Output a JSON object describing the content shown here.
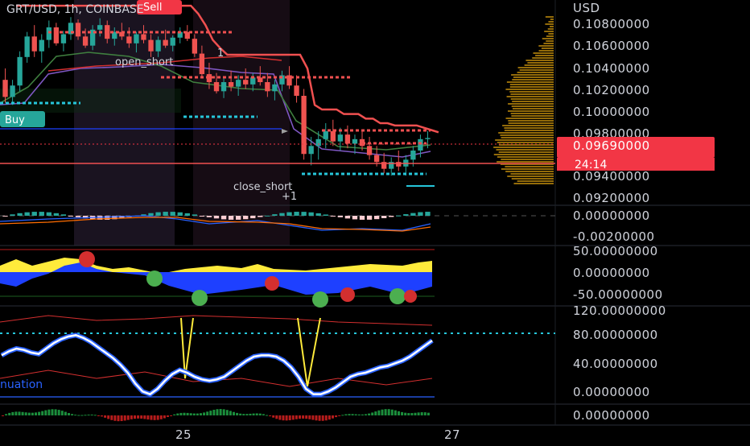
{
  "symbol": {
    "pair": "GRT/USD",
    "interval": "1h",
    "exchange": "COINBASE",
    "header_text": "GRT/USD, 1h, COINBASE"
  },
  "currency_label": "USD",
  "colors": {
    "background": "#000000",
    "candle_up": "#26a69a",
    "candle_down": "#ef5350",
    "price_badge": "#f23645",
    "sell_badge": "#f23645",
    "buy_badge": "#26a69a",
    "stop_line": "#f05050",
    "rsi_line": "#ffffff",
    "rsi_shadow": "#2962ff",
    "osc_fill_yellow": "#ffeb3b",
    "osc_fill_blue": "#1e40ff",
    "dotted_level": "#26c6da"
  },
  "annotations": {
    "sell_badge": "Sell",
    "buy_badge": "Buy",
    "open_short": "open_short",
    "open_short_count": "1",
    "close_short": "close_short",
    "close_short_count": "+1",
    "continuation": "nuation"
  },
  "last_price": {
    "value": "0.09690000",
    "countdown": "24:14"
  },
  "x_axis_labels": [
    "25",
    "27"
  ],
  "chart_data": [
    {
      "type": "candlestick",
      "panel": "price",
      "y_tick_labels": [
        "0.10800000",
        "0.10600000",
        "0.10400000",
        "0.10200000",
        "0.10000000",
        "0.09800000",
        "0.09400000",
        "0.09200000"
      ],
      "ylim": [
        0.091,
        0.109
      ],
      "last_price": 0.0969,
      "candles_ohlc": [
        [
          0.102,
          0.103,
          0.1,
          0.1005
        ],
        [
          0.1005,
          0.102,
          0.0998,
          0.1015
        ],
        [
          0.1015,
          0.1045,
          0.101,
          0.104
        ],
        [
          0.104,
          0.1062,
          0.1035,
          0.1058
        ],
        [
          0.1058,
          0.1068,
          0.104,
          0.1045
        ],
        [
          0.1045,
          0.106,
          0.1035,
          0.1055
        ],
        [
          0.1055,
          0.1072,
          0.1048,
          0.1066
        ],
        [
          0.1066,
          0.107,
          0.105,
          0.1052
        ],
        [
          0.1052,
          0.1063,
          0.1045,
          0.106
        ],
        [
          0.106,
          0.1075,
          0.1055,
          0.107
        ],
        [
          0.107,
          0.1073,
          0.1055,
          0.1058
        ],
        [
          0.1058,
          0.1065,
          0.1048,
          0.105
        ],
        [
          0.105,
          0.1068,
          0.1046,
          0.1064
        ],
        [
          0.1064,
          0.1074,
          0.1058,
          0.1068
        ],
        [
          0.1068,
          0.1072,
          0.1052,
          0.1056
        ],
        [
          0.1056,
          0.1066,
          0.105,
          0.1062
        ],
        [
          0.1062,
          0.107,
          0.1055,
          0.1058
        ],
        [
          0.1058,
          0.1066,
          0.1048,
          0.1052
        ],
        [
          0.1052,
          0.1062,
          0.1044,
          0.106
        ],
        [
          0.106,
          0.1068,
          0.1052,
          0.1055
        ],
        [
          0.1055,
          0.106,
          0.104,
          0.1045
        ],
        [
          0.1045,
          0.1058,
          0.104,
          0.1055
        ],
        [
          0.1055,
          0.1064,
          0.1048,
          0.105
        ],
        [
          0.105,
          0.1059,
          0.1045,
          0.1057
        ],
        [
          0.1057,
          0.1066,
          0.1052,
          0.1062
        ],
        [
          0.1062,
          0.1068,
          0.1054,
          0.1056
        ],
        [
          0.1056,
          0.106,
          0.104,
          0.1043
        ],
        [
          0.1043,
          0.105,
          0.1022,
          0.1025
        ],
        [
          0.1025,
          0.1035,
          0.1012,
          0.1018
        ],
        [
          0.1018,
          0.1026,
          0.1008,
          0.101
        ],
        [
          0.101,
          0.1022,
          0.1004,
          0.1018
        ],
        [
          0.1018,
          0.1028,
          0.101,
          0.1014
        ],
        [
          0.1014,
          0.1024,
          0.1006,
          0.102
        ],
        [
          0.102,
          0.103,
          0.1012,
          0.1016
        ],
        [
          0.1016,
          0.1026,
          0.101,
          0.1022
        ],
        [
          0.1022,
          0.1032,
          0.1015,
          0.1018
        ],
        [
          0.1018,
          0.1026,
          0.1005,
          0.101
        ],
        [
          0.101,
          0.102,
          0.1002,
          0.1016
        ],
        [
          0.1016,
          0.1028,
          0.101,
          0.1024
        ],
        [
          0.1024,
          0.1032,
          0.1012,
          0.1015
        ],
        [
          0.1015,
          0.1024,
          0.1,
          0.1006
        ],
        [
          0.1006,
          0.1012,
          0.095,
          0.0955
        ],
        [
          0.0955,
          0.097,
          0.0945,
          0.0962
        ],
        [
          0.0962,
          0.0975,
          0.095,
          0.0968
        ],
        [
          0.0968,
          0.0982,
          0.096,
          0.0975
        ],
        [
          0.0975,
          0.0985,
          0.0962,
          0.0966
        ],
        [
          0.0966,
          0.0978,
          0.0958,
          0.0972
        ],
        [
          0.0972,
          0.098,
          0.096,
          0.0964
        ],
        [
          0.0964,
          0.0972,
          0.0955,
          0.0968
        ],
        [
          0.0968,
          0.0976,
          0.0958,
          0.0962
        ],
        [
          0.0962,
          0.097,
          0.095,
          0.0954
        ],
        [
          0.0954,
          0.0962,
          0.0944,
          0.0948
        ],
        [
          0.0948,
          0.0956,
          0.0938,
          0.0942
        ],
        [
          0.0942,
          0.0952,
          0.0936,
          0.0948
        ],
        [
          0.0948,
          0.0958,
          0.094,
          0.0944
        ],
        [
          0.0944,
          0.0954,
          0.0936,
          0.095
        ],
        [
          0.095,
          0.0962,
          0.0944,
          0.0958
        ],
        [
          0.0958,
          0.0972,
          0.0952,
          0.0968
        ],
        [
          0.0968,
          0.0975,
          0.096,
          0.0969
        ]
      ],
      "stop_line": [
        0.1085,
        0.1085,
        0.1085,
        0.1085,
        0.1085,
        0.1085,
        0.1085,
        0.1085,
        0.1085,
        0.1085,
        0.1085,
        0.1085,
        0.1085,
        0.1085,
        0.1085,
        0.1085,
        0.1085,
        0.1085,
        0.1085,
        0.1085,
        0.1085,
        0.1085,
        0.1085,
        0.1085,
        0.1085,
        0.1078,
        0.1068,
        0.1055,
        0.1048,
        0.1042,
        0.1042,
        0.1042,
        0.1042,
        0.1042,
        0.1042,
        0.1042,
        0.1042,
        0.1042,
        0.1042,
        0.1042,
        0.103,
        0.0998,
        0.0994,
        0.0994,
        0.0994,
        0.099,
        0.099,
        0.099,
        0.0986,
        0.0986,
        0.0982,
        0.0982,
        0.098,
        0.098,
        0.098,
        0.098,
        0.0978,
        0.0976,
        0.0974
      ],
      "horizontal_level": 0.0965
    },
    {
      "type": "histogram",
      "panel": "macd",
      "y_tick_labels": [
        "0.00000000",
        "-0.00200000"
      ]
    },
    {
      "type": "area",
      "panel": "oscillator",
      "y_tick_labels": [
        "50.00000000",
        "0.00000000",
        "-50.00000000"
      ]
    },
    {
      "type": "line",
      "panel": "rsi",
      "y_tick_labels": [
        "120.00000000",
        "80.00000000",
        "40.00000000",
        "0.00000000"
      ],
      "series_values": [
        62,
        68,
        72,
        70,
        66,
        64,
        72,
        80,
        86,
        90,
        92,
        88,
        82,
        74,
        66,
        58,
        48,
        36,
        20,
        8,
        4,
        12,
        24,
        34,
        40,
        36,
        30,
        26,
        24,
        26,
        30,
        38,
        46,
        54,
        60,
        62,
        62,
        60,
        54,
        44,
        30,
        12,
        4,
        4,
        8,
        14,
        22,
        30,
        34,
        36,
        40,
        44,
        46,
        50,
        54,
        60,
        68,
        76,
        84
      ]
    },
    {
      "type": "histogram",
      "panel": "volume_oscillator",
      "y_tick_labels": [
        "0.00000000"
      ]
    }
  ]
}
